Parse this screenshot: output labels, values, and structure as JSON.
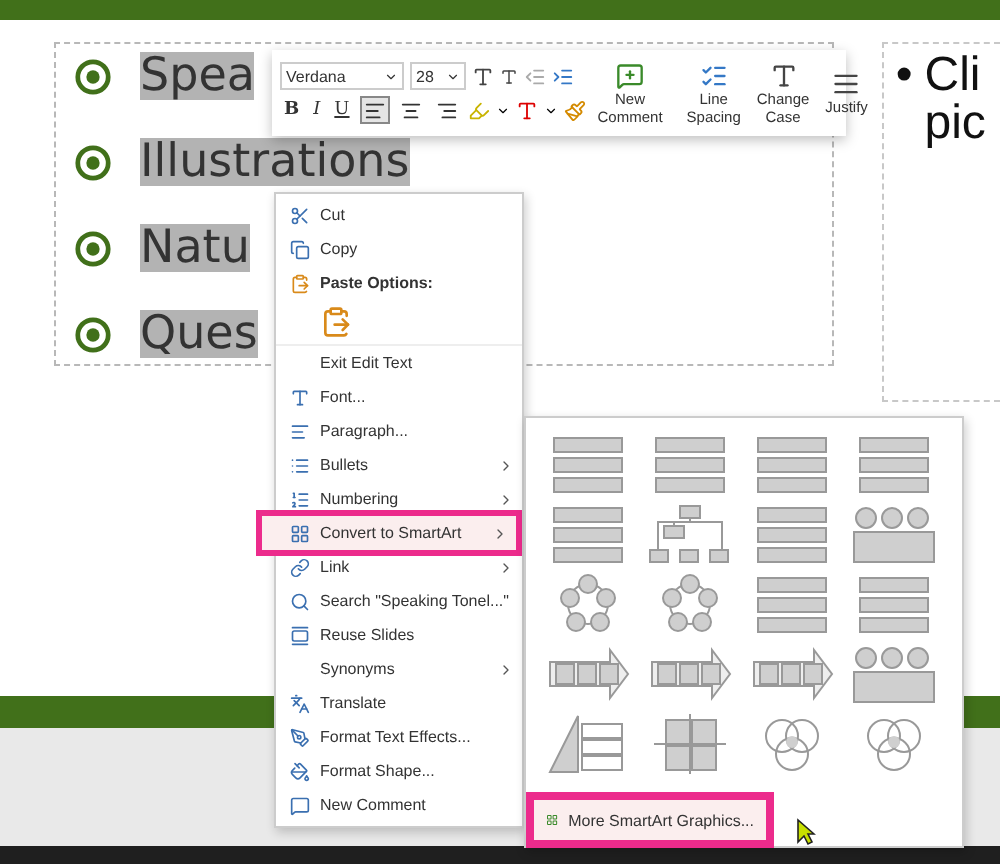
{
  "slide": {
    "bullets": [
      {
        "text": "Spea"
      },
      {
        "text": "Illustrations"
      },
      {
        "text": "Natu"
      },
      {
        "text": "Ques"
      }
    ],
    "side_placeholder": {
      "bullet": "•",
      "lines": [
        "Cli",
        "pic"
      ]
    }
  },
  "mini_toolbar": {
    "font": "Verdana",
    "size": "28",
    "bold": "B",
    "italic": "I",
    "underline": "U",
    "alignments": [
      {
        "kind": "left",
        "selected": true
      },
      {
        "kind": "center",
        "selected": false
      },
      {
        "kind": "right",
        "selected": false
      }
    ],
    "new_comment": "New Comment",
    "line_spacing": "Line Spacing",
    "change_case": "Change Case",
    "justify": "Justify"
  },
  "context_menu": {
    "items": [
      {
        "kind": "command",
        "label": "Cut",
        "submenu": false,
        "marked": false
      },
      {
        "kind": "command",
        "label": "Copy",
        "submenu": false,
        "marked": false
      },
      {
        "kind": "header",
        "label": "Paste Options:"
      },
      {
        "kind": "paste-option"
      },
      {
        "kind": "command",
        "label": "Exit Edit Text",
        "submenu": false,
        "marked": false
      },
      {
        "kind": "command",
        "label": "Font...",
        "submenu": false,
        "marked": false
      },
      {
        "kind": "command",
        "label": "Paragraph...",
        "submenu": false,
        "marked": false
      },
      {
        "kind": "command",
        "label": "Bullets",
        "submenu": true,
        "marked": false
      },
      {
        "kind": "command",
        "label": "Numbering",
        "submenu": true,
        "marked": false
      },
      {
        "kind": "command",
        "label": "Convert to SmartArt",
        "submenu": true,
        "marked": true
      },
      {
        "kind": "command",
        "label": "Link",
        "submenu": true,
        "marked": false
      },
      {
        "kind": "command",
        "label": "Search \"Speaking Tonel...\"",
        "submenu": false,
        "marked": false
      },
      {
        "kind": "command",
        "label": "Reuse Slides",
        "submenu": false,
        "marked": false
      },
      {
        "kind": "command",
        "label": "Synonyms",
        "submenu": true,
        "marked": false
      },
      {
        "kind": "command",
        "label": "Translate",
        "submenu": false,
        "marked": false
      },
      {
        "kind": "command",
        "label": "Format Text Effects...",
        "submenu": false,
        "marked": false
      },
      {
        "kind": "command",
        "label": "Format Shape...",
        "submenu": false,
        "marked": false
      },
      {
        "kind": "command",
        "label": "New Comment",
        "submenu": false,
        "marked": false
      }
    ]
  },
  "smartart_submenu": {
    "layouts": [
      {
        "kind": "list"
      },
      {
        "kind": "list"
      },
      {
        "kind": "list"
      },
      {
        "kind": "list"
      },
      {
        "kind": "list"
      },
      {
        "kind": "hierarchy"
      },
      {
        "kind": "list"
      },
      {
        "kind": "picture"
      },
      {
        "kind": "cycle"
      },
      {
        "kind": "cycle"
      },
      {
        "kind": "list"
      },
      {
        "kind": "list"
      },
      {
        "kind": "process"
      },
      {
        "kind": "process"
      },
      {
        "kind": "process"
      },
      {
        "kind": "picture"
      },
      {
        "kind": "pyramid"
      },
      {
        "kind": "matrix"
      },
      {
        "kind": "relationship"
      },
      {
        "kind": "relationship"
      }
    ],
    "more": {
      "label": "More SmartArt Graphics...",
      "marked": true
    }
  }
}
